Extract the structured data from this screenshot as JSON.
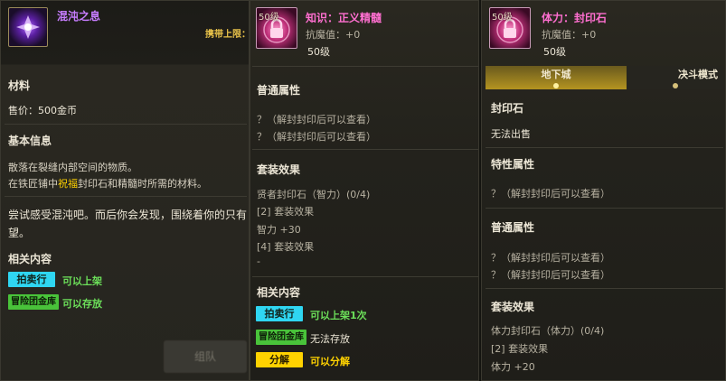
{
  "colors": {
    "purple_title": "#c77dff",
    "pink_title": "#ff6fd0",
    "gold": "#e8c24a",
    "cyan": "#2fd6f2",
    "green_text": "#6ce05a",
    "yellow_text": "#ffd200"
  },
  "panel1": {
    "name": "混沌之息",
    "carry_limit": "携带上限：",
    "material_header": "材料",
    "price": "售价：500金币",
    "basic_info_header": "基本信息",
    "desc_line1": "散落在裂缝内部空间的物质。",
    "desc_line2_a": "在铁匠铺中",
    "desc_line2_b": "祝福",
    "desc_line2_c": "封印石和精髓时所需的材料。",
    "flavor_line1": "尝试感受混沌吧。而后你会发现，围绕着你的只有",
    "flavor_line2": "望。",
    "related_header": "相关内容",
    "auction_label": "拍卖行",
    "auction_text": "可以上架",
    "guild_label": "冒险团金库",
    "guild_text": "可以存放",
    "ghost_button": "组队"
  },
  "panel2": {
    "level_badge": "50级",
    "name": "知识：正义精髓",
    "resist": "抗魔值：+0",
    "level": "50级",
    "common_header": "普通属性",
    "common_1": "？（解封封印后可以查看）",
    "common_2": "？（解封封印后可以查看）",
    "set_header": "套装效果",
    "set_name": "贤者封印石（智力）(0/4)",
    "set_2": "[2] 套装效果",
    "set_2_val": "智力 +30",
    "set_4": "[4] 套装效果",
    "set_4_val": "-",
    "related_header": "相关内容",
    "auction_label": "拍卖行",
    "auction_text": "可以上架1次",
    "guild_label": "冒险团金库",
    "guild_text": "无法存放",
    "dismantle_label": "分解",
    "dismantle_text": "可以分解"
  },
  "panel3": {
    "level_badge": "50级",
    "name": "体力：封印石",
    "resist": "抗魔值：+0",
    "level": "50级",
    "tab_dungeon": "地下城",
    "tab_pvp": "决斗模式",
    "seal_header": "封印石",
    "cannot_sell": "无法出售",
    "special_header": "特性属性",
    "special_1": "？（解封封印后可以查看）",
    "common_header": "普通属性",
    "common_1": "？（解封封印后可以查看）",
    "common_2": "？（解封封印后可以查看）",
    "set_header": "套装效果",
    "set_name": "体力封印石（体力）(0/4)",
    "set_2": "[2] 套装效果",
    "set_2_val": "体力 +20"
  },
  "icons": {
    "p1": "chaos-orb-icon",
    "p2": "pink-lock-seal-icon",
    "p3": "pink-lock-seal-icon"
  }
}
